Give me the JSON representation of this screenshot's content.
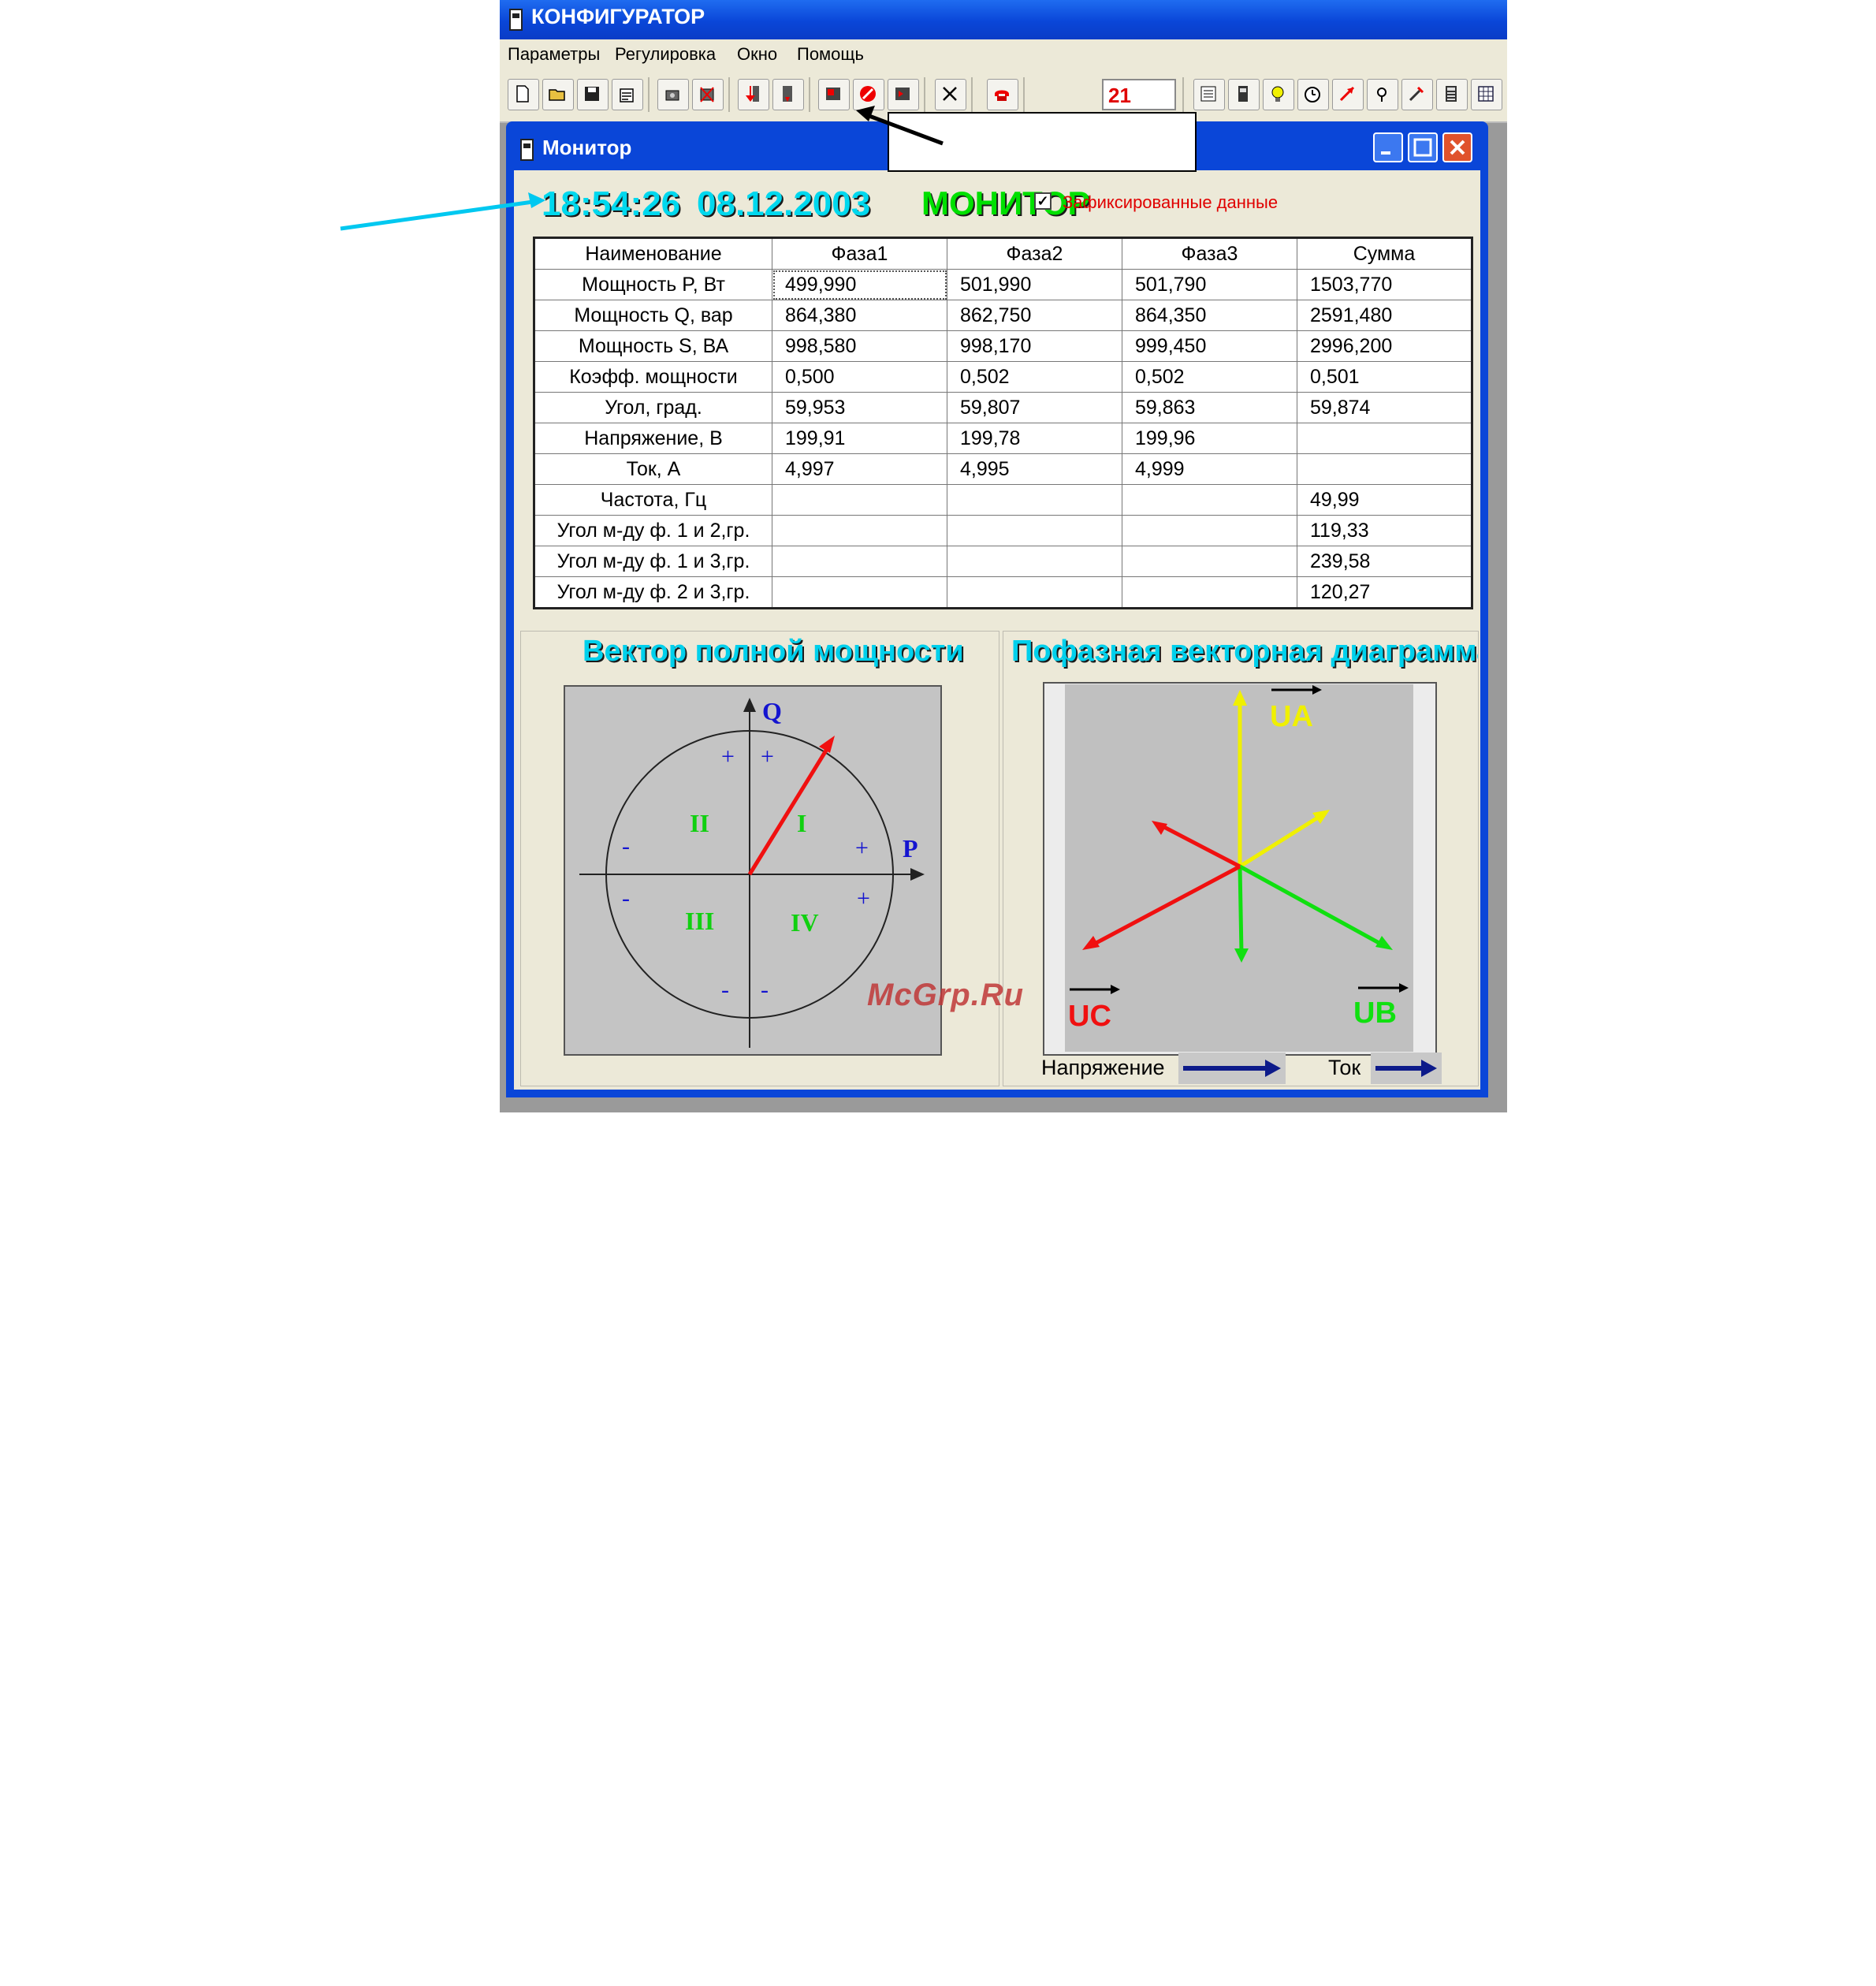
{
  "app": {
    "title": "КОНФИГУРАТОР",
    "menu": [
      "Параметры",
      "Регулировка",
      "Окно",
      "Помощь"
    ],
    "counter_value": "21"
  },
  "monitor": {
    "window_title": "Монитор",
    "time": "18:54:26",
    "date": "08.12.2003",
    "label": "МОНИТОР",
    "fixed_data_checked": true,
    "fixed_data_label": "Зафиксированные  данные"
  },
  "table": {
    "headers": [
      "Наименование",
      "Фаза1",
      "Фаза2",
      "Фаза3",
      "Сумма"
    ],
    "rows": [
      [
        "Мощность P, Вт",
        "499,990",
        "501,990",
        "501,790",
        "1503,770"
      ],
      [
        "Мощность Q, вар",
        "864,380",
        "862,750",
        "864,350",
        "2591,480"
      ],
      [
        "Мощность S, ВА",
        "998,580",
        "998,170",
        "999,450",
        "2996,200"
      ],
      [
        "Коэфф. мощности",
        "0,500",
        "0,502",
        "0,502",
        "0,501"
      ],
      [
        "Угол, град.",
        "59,953",
        "59,807",
        "59,863",
        "59,874"
      ],
      [
        "Напряжение, В",
        "199,91",
        "199,78",
        "199,96",
        ""
      ],
      [
        "Ток, А",
        "4,997",
        "4,995",
        "4,999",
        ""
      ],
      [
        "Частота, Гц",
        "",
        "",
        "",
        "49,99"
      ],
      [
        "Угол м-ду ф. 1 и 2,гр.",
        "",
        "",
        "",
        "119,33"
      ],
      [
        "Угол м-ду ф. 1 и 3,гр.",
        "",
        "",
        "",
        "239,58"
      ],
      [
        "Угол м-ду ф. 2 и 3,гр.",
        "",
        "",
        "",
        "120,27"
      ]
    ]
  },
  "power_vector": {
    "title": "Вектор полной мощности",
    "axis_q": "Q",
    "axis_p": "P",
    "quadrants": [
      "I",
      "II",
      "III",
      "IV"
    ],
    "plus": "+",
    "minus": "-"
  },
  "phase_diagram": {
    "title": "Пофазная векторная диаграмма",
    "ua": "UA",
    "ub": "UB",
    "uc": "UC",
    "legend_voltage": "Напряжение",
    "legend_current": "Ток"
  },
  "colors": {
    "titlebar": "#0a46d8",
    "phase_a": "#f0f000",
    "phase_b": "#00e000",
    "phase_c": "#f01010",
    "legend_arrow": "#0c1a8a"
  },
  "watermark": "McGrp.Ru"
}
